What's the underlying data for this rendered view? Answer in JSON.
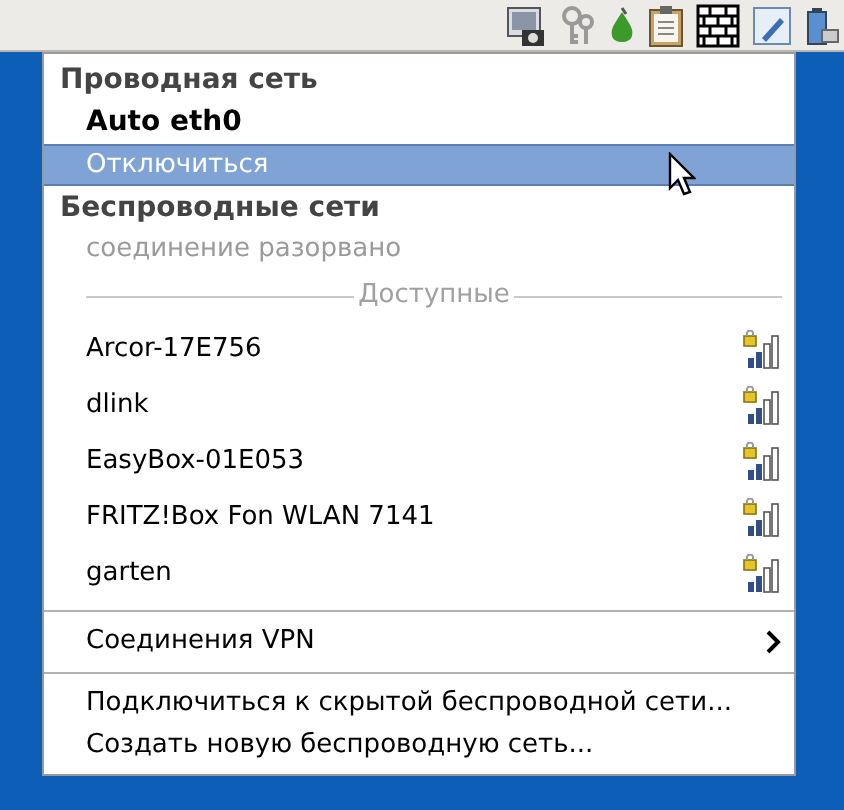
{
  "menu": [
    {
      "kind": "header",
      "text": "Проводная сеть"
    },
    {
      "kind": "item",
      "text": "Auto eth0",
      "active": true,
      "selected": false
    },
    {
      "kind": "item",
      "text": "Отключиться",
      "active": false,
      "selected": true
    },
    {
      "kind": "header",
      "text": "Беспроводные сети"
    },
    {
      "kind": "status",
      "text": "соединение разорвано"
    },
    {
      "kind": "labeled_rule",
      "text": "Доступные"
    },
    {
      "kind": "network",
      "text": "Arcor-17E756",
      "selected": false
    },
    {
      "kind": "network",
      "text": "dlink",
      "selected": false
    },
    {
      "kind": "network",
      "text": "EasyBox-01E053",
      "selected": false
    },
    {
      "kind": "network",
      "text": "FRITZ!Box Fon WLAN 7141",
      "selected": false
    },
    {
      "kind": "network",
      "text": "garten",
      "selected": false
    },
    {
      "kind": "rule"
    },
    {
      "kind": "submenu",
      "text": "Соединения VPN",
      "selected": false
    },
    {
      "kind": "rule"
    },
    {
      "kind": "item",
      "text": "Подключиться к скрытой беспроводной сети...",
      "active": false,
      "selected": false
    },
    {
      "kind": "item",
      "text": "Создать новую беспроводную сеть...",
      "active": false,
      "selected": false
    }
  ]
}
